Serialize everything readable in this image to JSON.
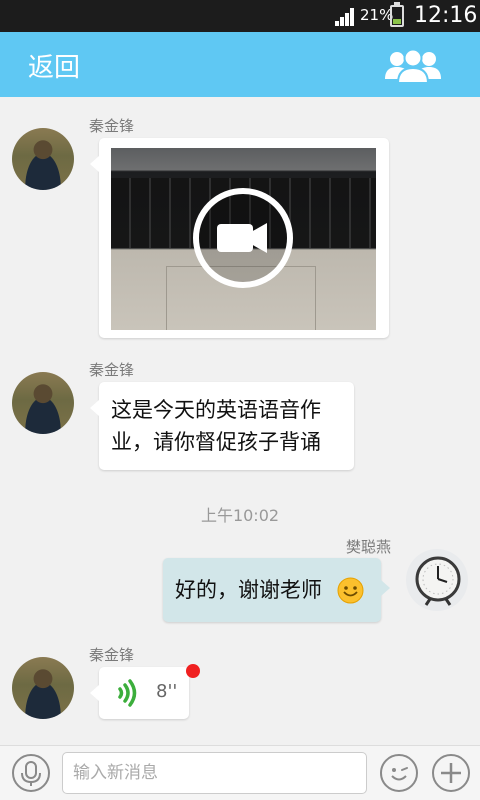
{
  "status_bar": {
    "battery_percent": "21%",
    "time": "12:16"
  },
  "header": {
    "back_label": "返回",
    "group_icon": "group-members-icon"
  },
  "chat": {
    "messages": [
      {
        "sender": "秦金锋",
        "type": "video",
        "icon": "video-camera-icon"
      },
      {
        "sender": "秦金锋",
        "type": "text",
        "lines": [
          "这是今天的英语语音作",
          "业，请你督促孩子背诵"
        ]
      },
      {
        "type": "timestamp",
        "text": "上午10:02"
      },
      {
        "sender": "樊聪燕",
        "type": "text",
        "text": "好的，谢谢老师",
        "emoji": "smiley-emoji-icon"
      },
      {
        "sender": "秦金锋",
        "type": "voice",
        "duration": "8''",
        "unread": true
      }
    ]
  },
  "input_bar": {
    "placeholder": "输入新消息",
    "icons": [
      "microphone-icon",
      "emoji-icon",
      "plus-icon"
    ]
  },
  "colors": {
    "header": "#5fc8f3",
    "sent_bubble": "#d2e6e9",
    "voice_icon": "#3cae3c",
    "unread_dot": "#f02020"
  }
}
